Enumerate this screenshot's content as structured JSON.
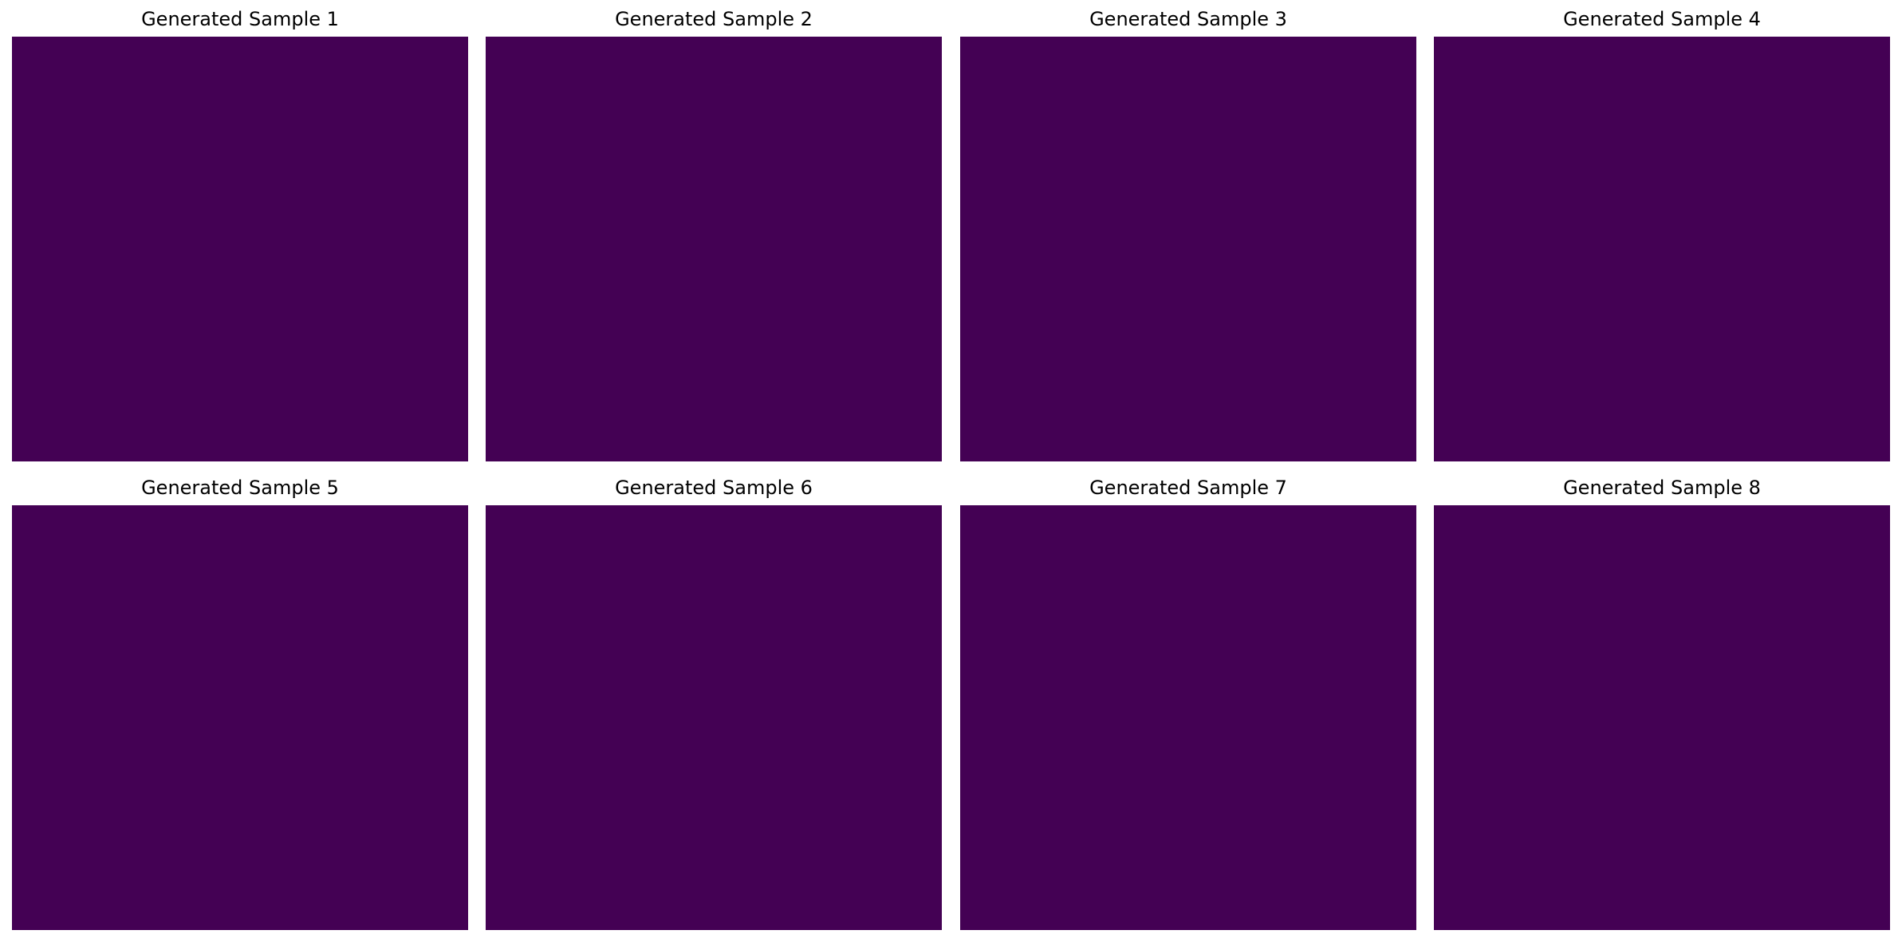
{
  "fill_color": "#440154",
  "samples": [
    {
      "title": "Generated Sample 1"
    },
    {
      "title": "Generated Sample 2"
    },
    {
      "title": "Generated Sample 3"
    },
    {
      "title": "Generated Sample 4"
    },
    {
      "title": "Generated Sample 5"
    },
    {
      "title": "Generated Sample 6"
    },
    {
      "title": "Generated Sample 7"
    },
    {
      "title": "Generated Sample 8"
    }
  ]
}
